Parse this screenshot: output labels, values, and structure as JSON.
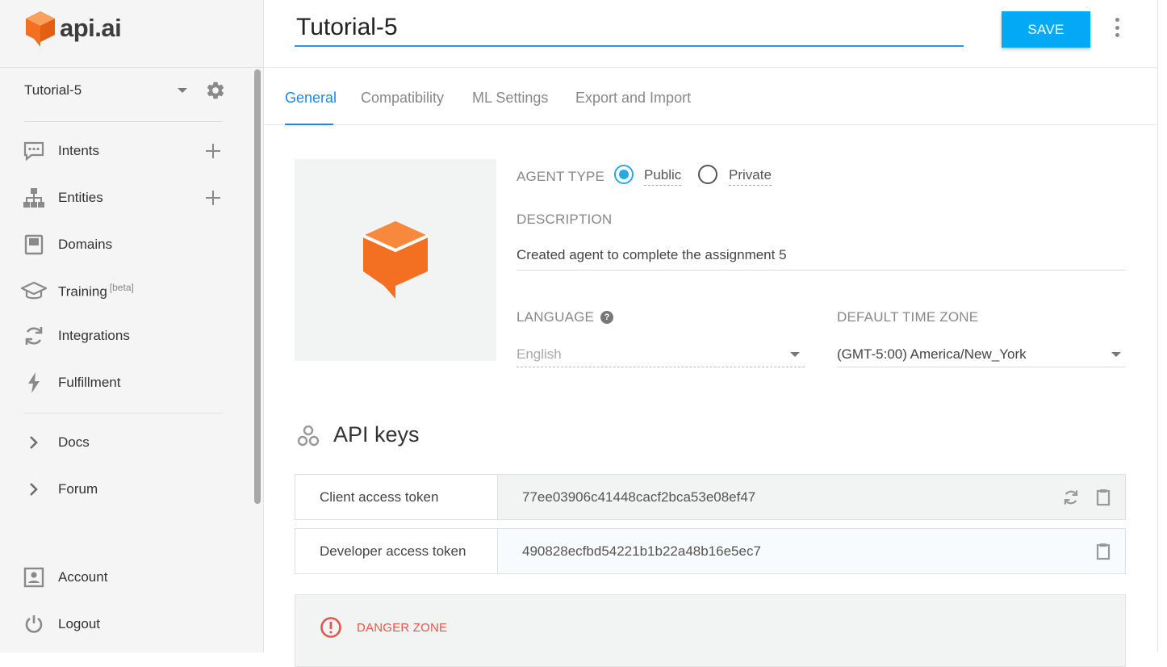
{
  "brand": {
    "name": "api.ai",
    "accent": "#f36f21"
  },
  "sidebar": {
    "agent_name": "Tutorial-5",
    "items": [
      {
        "label": "Intents",
        "icon": "chat-icon",
        "addable": true
      },
      {
        "label": "Entities",
        "icon": "hierarchy-icon",
        "addable": true
      },
      {
        "label": "Domains",
        "icon": "book-icon",
        "addable": false
      },
      {
        "label": "Training",
        "badge": "[beta]",
        "icon": "graduation-cap-icon",
        "addable": false
      },
      {
        "label": "Integrations",
        "icon": "sync-icon",
        "addable": false
      },
      {
        "label": "Fulfillment",
        "icon": "lightning-icon",
        "addable": false
      }
    ],
    "links": [
      {
        "label": "Docs",
        "icon": "chevron-right-icon"
      },
      {
        "label": "Forum",
        "icon": "chevron-right-icon"
      }
    ],
    "footer": [
      {
        "label": "Account",
        "icon": "account-icon"
      },
      {
        "label": "Logout",
        "icon": "power-icon"
      }
    ]
  },
  "header": {
    "title_value": "Tutorial-5",
    "save_label": "SAVE"
  },
  "tabs": [
    {
      "label": "General",
      "active": true
    },
    {
      "label": "Compatibility",
      "active": false
    },
    {
      "label": "ML Settings",
      "active": false
    },
    {
      "label": "Export and Import",
      "active": false
    }
  ],
  "general": {
    "agent_type_label": "AGENT TYPE",
    "agent_type_options": [
      "Public",
      "Private"
    ],
    "agent_type_selected": "Public",
    "description_label": "DESCRIPTION",
    "description_value": "Created agent to complete the assignment 5",
    "language_label": "LANGUAGE",
    "language_value": "English",
    "timezone_label": "DEFAULT TIME ZONE",
    "timezone_value": "(GMT-5:00) America/New_York"
  },
  "api_keys": {
    "title": "API keys",
    "client_label": "Client access token",
    "client_value": "77ee03906c41448cacf2bca53e08ef47",
    "developer_label": "Developer access token",
    "developer_value": "490828ecfbd54221b1b22a48b16e5ec7"
  },
  "danger_zone": {
    "label": "DANGER ZONE",
    "color": "#e2574c"
  },
  "colors": {
    "primary": "#03a9f4",
    "tab_active": "#1e88e5",
    "radio": "#29a8e6"
  }
}
